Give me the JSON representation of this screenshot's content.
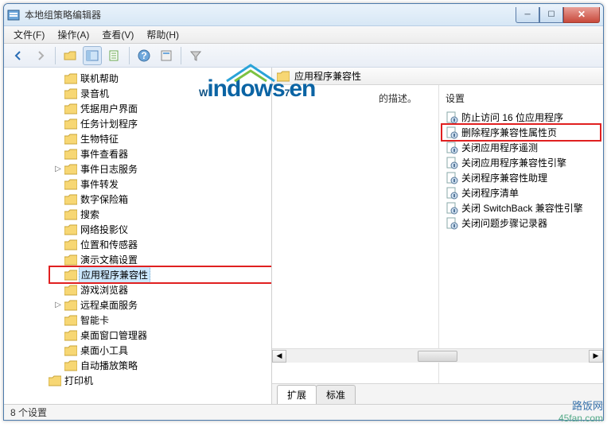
{
  "window": {
    "title": "本地组策略编辑器"
  },
  "menu": {
    "file": "文件(F)",
    "action": "操作(A)",
    "view": "查看(V)",
    "help": "帮助(H)"
  },
  "tree": {
    "items": [
      {
        "label": "联机帮助",
        "exp": ""
      },
      {
        "label": "录音机",
        "exp": ""
      },
      {
        "label": "凭据用户界面",
        "exp": ""
      },
      {
        "label": "任务计划程序",
        "exp": ""
      },
      {
        "label": "生物特征",
        "exp": ""
      },
      {
        "label": "事件查看器",
        "exp": ""
      },
      {
        "label": "事件日志服务",
        "exp": "▷"
      },
      {
        "label": "事件转发",
        "exp": ""
      },
      {
        "label": "数字保险箱",
        "exp": ""
      },
      {
        "label": "搜索",
        "exp": ""
      },
      {
        "label": "网络投影仪",
        "exp": ""
      },
      {
        "label": "位置和传感器",
        "exp": ""
      },
      {
        "label": "演示文稿设置",
        "exp": ""
      },
      {
        "label": "应用程序兼容性",
        "exp": "",
        "selected": true,
        "highlight": true
      },
      {
        "label": "游戏浏览器",
        "exp": ""
      },
      {
        "label": "远程桌面服务",
        "exp": "▷"
      },
      {
        "label": "智能卡",
        "exp": ""
      },
      {
        "label": "桌面窗口管理器",
        "exp": ""
      },
      {
        "label": "桌面小工具",
        "exp": ""
      },
      {
        "label": "自动播放策略",
        "exp": ""
      }
    ],
    "extra": "打印机"
  },
  "right": {
    "header": "应用程序兼容性",
    "desc_tail": "的描述。",
    "settings_header": "设置",
    "items": [
      {
        "label": "防止访问 16 位应用程序"
      },
      {
        "label": "删除程序兼容性属性页",
        "highlight": true
      },
      {
        "label": "关闭应用程序遥测"
      },
      {
        "label": "关闭应用程序兼容性引擎"
      },
      {
        "label": "关闭程序兼容性助理"
      },
      {
        "label": "关闭程序清单"
      },
      {
        "label": "关闭 SwitchBack 兼容性引擎"
      },
      {
        "label": "关闭问题步骤记录器"
      }
    ],
    "tabs": {
      "extended": "扩展",
      "standard": "标准"
    }
  },
  "status": "8 个设置",
  "brand": {
    "cn": "路饭网",
    "url": "45fan.com"
  },
  "watermark": "Windows7en"
}
